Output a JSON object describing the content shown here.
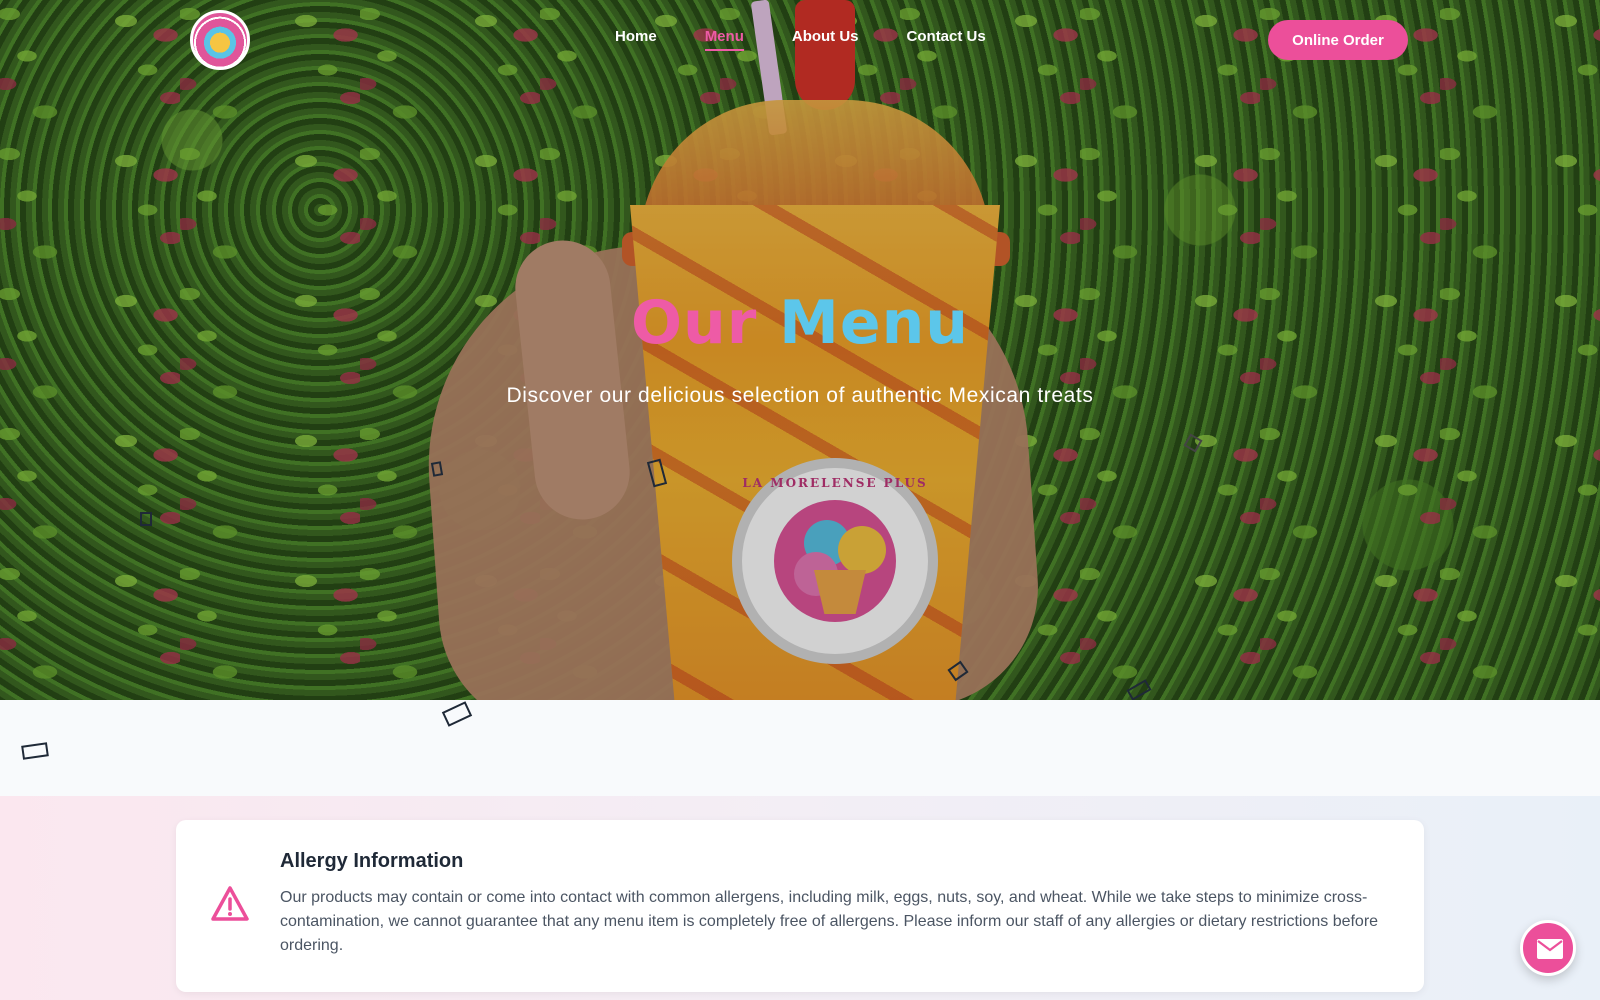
{
  "nav": {
    "links": [
      {
        "label": "Home",
        "active": false
      },
      {
        "label": "Menu",
        "active": true
      },
      {
        "label": "About Us",
        "active": false
      },
      {
        "label": "Contact Us",
        "active": false
      }
    ],
    "order_button": "Online Order"
  },
  "hero": {
    "title_word1": "Our",
    "title_word2": "Menu",
    "subtitle": "Discover our delicious selection of authentic Mexican treats",
    "sticker_text": "LA MORELENSE PLUS"
  },
  "allergy": {
    "icon": "warning-triangle-icon",
    "title": "Allergy Information",
    "text": "Our products may contain or come into contact with common allergens, including milk, eggs, nuts, soy, and wheat. While we take steps to minimize cross-contamination, we cannot guarantee that any menu item is completely free of allergens. Please inform our staff of any allergies or dietary restrictions before ordering."
  },
  "fab": {
    "icon": "envelope-icon"
  },
  "colors": {
    "accent_pink": "#ec4f9a",
    "accent_blue": "#5cc6ea",
    "text_dark": "#1f2937",
    "text_muted": "#4b5563"
  }
}
